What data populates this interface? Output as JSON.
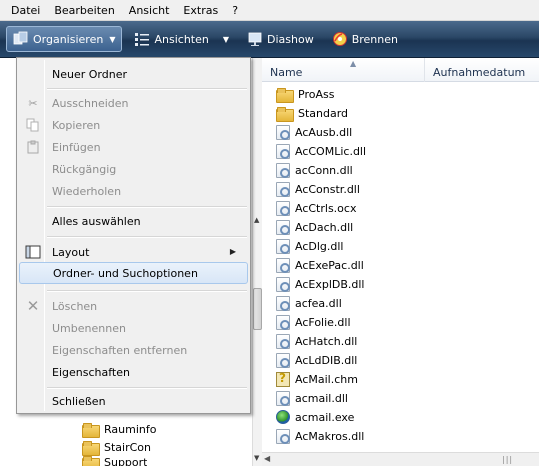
{
  "menubar": {
    "items": [
      "Datei",
      "Bearbeiten",
      "Ansicht",
      "Extras",
      "?"
    ]
  },
  "toolbar": {
    "organize": "Organisieren",
    "views": "Ansichten",
    "slideshow": "Diashow",
    "burn": "Brennen"
  },
  "menu": {
    "new_folder": "Neuer Ordner",
    "cut": "Ausschneiden",
    "copy": "Kopieren",
    "paste": "Einfügen",
    "undo": "Rückgängig",
    "redo": "Wiederholen",
    "select_all": "Alles auswählen",
    "layout": "Layout",
    "folder_options": "Ordner- und Suchoptionen",
    "delete": "Löschen",
    "rename": "Umbenennen",
    "remove_properties": "Eigenschaften entfernen",
    "properties": "Eigenschaften",
    "close": "Schließen"
  },
  "nav": {
    "folders": [
      "Rauminfo",
      "StairCon",
      "Support"
    ]
  },
  "columns": {
    "name": "Name",
    "date": "Aufnahmedatum"
  },
  "files": [
    {
      "name": "ProAss",
      "type": "folder"
    },
    {
      "name": "Standard",
      "type": "folder"
    },
    {
      "name": "AcAusb.dll",
      "type": "dll"
    },
    {
      "name": "AcCOMLic.dll",
      "type": "dll"
    },
    {
      "name": "acConn.dll",
      "type": "dll"
    },
    {
      "name": "AcConstr.dll",
      "type": "dll"
    },
    {
      "name": "AcCtrls.ocx",
      "type": "dll"
    },
    {
      "name": "AcDach.dll",
      "type": "dll"
    },
    {
      "name": "AcDlg.dll",
      "type": "dll"
    },
    {
      "name": "AcExePac.dll",
      "type": "dll"
    },
    {
      "name": "AcExplDB.dll",
      "type": "dll"
    },
    {
      "name": "acfea.dll",
      "type": "dll"
    },
    {
      "name": "AcFolie.dll",
      "type": "dll"
    },
    {
      "name": "AcHatch.dll",
      "type": "dll"
    },
    {
      "name": "AcLdDIB.dll",
      "type": "dll"
    },
    {
      "name": "AcMail.chm",
      "type": "chm"
    },
    {
      "name": "acmail.dll",
      "type": "dll"
    },
    {
      "name": "acmail.exe",
      "type": "exe"
    },
    {
      "name": "AcMakros.dll",
      "type": "dll"
    }
  ]
}
